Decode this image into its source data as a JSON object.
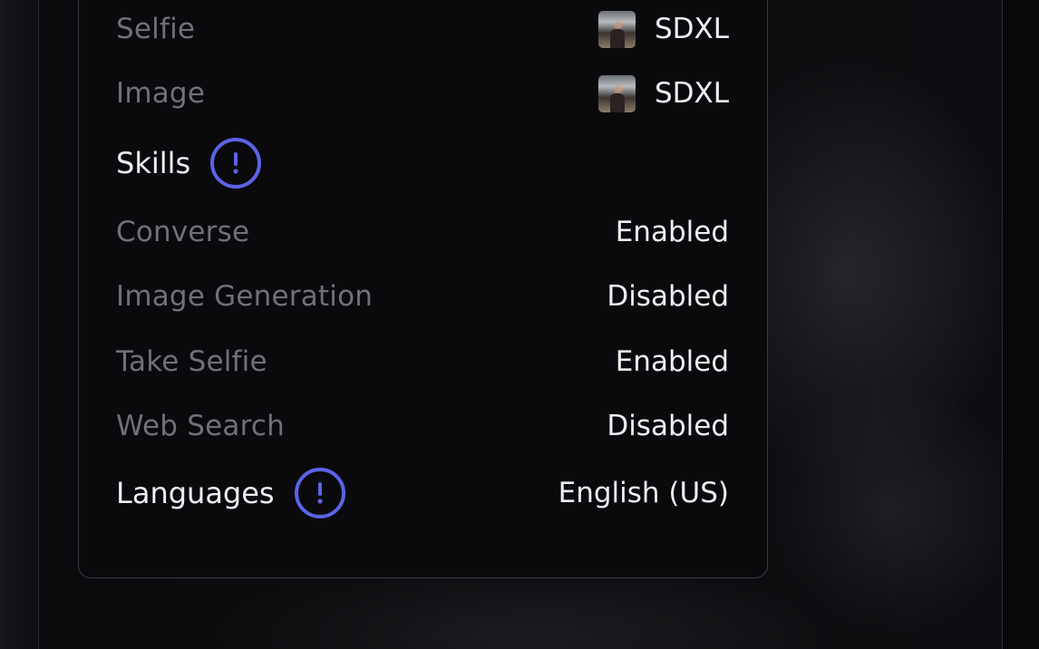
{
  "models": [
    {
      "label": "Selfie",
      "value": "SDXL",
      "icon": "model-thumbnail-icon"
    },
    {
      "label": "Image",
      "value": "SDXL",
      "icon": "model-thumbnail-icon"
    }
  ],
  "skills": {
    "heading": "Skills",
    "info_icon": "info-icon",
    "items": [
      {
        "label": "Converse",
        "value": "Enabled"
      },
      {
        "label": "Image Generation",
        "value": "Disabled"
      },
      {
        "label": "Take Selfie",
        "value": "Enabled"
      },
      {
        "label": "Web Search",
        "value": "Disabled"
      }
    ]
  },
  "languages": {
    "heading": "Languages",
    "info_icon": "info-icon",
    "value": "English (US)"
  },
  "colors": {
    "accent": "#5b63e6",
    "label_muted": "#6f7079",
    "text_primary": "#eceef2",
    "card_bg": "#0a0a0d",
    "card_border": "#3a3b42"
  }
}
